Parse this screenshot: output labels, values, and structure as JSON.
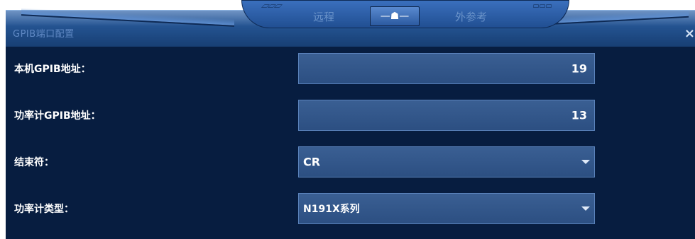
{
  "window": {
    "title": "GPIB端口配置",
    "close_symbol": "×"
  },
  "nav": {
    "left_deco": "▱▱▱",
    "right_deco": "▱▱▱",
    "tab_remote": "远程",
    "home_label": "—☗—",
    "tab_external": "外参考"
  },
  "form": {
    "local_gpib": {
      "label": "本机GPIB地址：",
      "value": "19"
    },
    "meter_gpib": {
      "label": "功率计GPIB地址：",
      "value": "13"
    },
    "terminator": {
      "label": "结束符：",
      "value": "CR"
    },
    "meter_type": {
      "label": "功率计类型：",
      "value": "N191X系列"
    }
  },
  "colors": {
    "panel_bg": "#071d40",
    "field_bg": "#3a5f93",
    "accent": "#2b5aa0"
  }
}
